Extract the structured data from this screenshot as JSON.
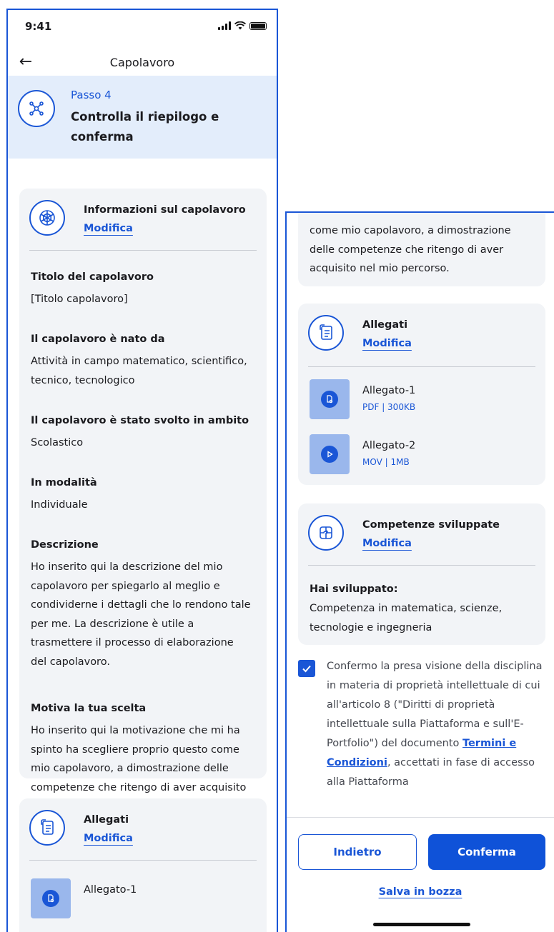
{
  "status": {
    "time": "9:41"
  },
  "header": {
    "back_icon": "arrow-left-icon",
    "title": "Capolavoro"
  },
  "step": {
    "icon": "network-icon",
    "label": "Passo 4",
    "title": "Controlla il riepilogo e conferma"
  },
  "info_card": {
    "icon": "globe-grid-icon",
    "title": "Informazioni sul capolavoro",
    "edit_label": "Modifica",
    "fields": [
      {
        "label": "Titolo del capolavoro",
        "value": "[Titolo capolavoro]"
      },
      {
        "label": "Il capolavoro è nato da",
        "value": "Attività in campo matematico, scientifico, tecnico, tecnologico"
      },
      {
        "label": "Il capolavoro è stato svolto in ambito",
        "value": "Scolastico"
      },
      {
        "label": "In modalità",
        "value": "Individuale"
      },
      {
        "label": "Descrizione",
        "value": "Ho inserito qui la descrizione del mio capolavoro per spiegarlo al meglio e condividerne i dettagli che lo rendono tale per me. La descrizione è utile a trasmettere il processo di elaborazione del capolavoro."
      },
      {
        "label": "Motiva la tua scelta",
        "value": "Ho inserito qui la motivazione che mi ha spinto ha scegliere proprio questo come mio capolavoro, a dimostrazione delle competenze che ritengo di aver acquisito nel mio percorso."
      }
    ]
  },
  "scrolled_motivation_tail": "come mio capolavoro, a dimostrazione delle competenze che ritengo di aver acquisito nel mio percorso.",
  "attachments_card": {
    "icon": "document-list-icon",
    "title": "Allegati",
    "edit_label": "Modifica",
    "items": [
      {
        "name": "Allegato-1",
        "meta": "PDF | 300KB",
        "icon": "file-icon"
      },
      {
        "name": "Allegato-2",
        "meta": "MOV | 1MB",
        "icon": "play-icon"
      }
    ]
  },
  "skills_card": {
    "icon": "puzzle-icon",
    "title": "Competenze sviluppate",
    "edit_label": "Modifica",
    "label": "Hai sviluppato:",
    "value": "Competenza in matematica, scienze, tecnologie e ingegneria"
  },
  "consent": {
    "checked": true,
    "text_before": "Confermo la presa visione della disciplina in materia di proprietà intellettuale di cui all'articolo 8 (\"Diritti di proprietà intellettuale sulla Piattaforma e sull'E-Portfolio\") del documento ",
    "link_label": "Termini e Condizioni",
    "text_after": ", accettati in fase di accesso alla Piattaforma"
  },
  "actions": {
    "back_label": "Indietro",
    "confirm_label": "Conferma",
    "draft_label": "Salva in bozza"
  },
  "colors": {
    "accent": "#1a56d6",
    "banner": "#e3edfb",
    "card": "#f2f4f7",
    "thumb": "#9ab7ec"
  }
}
